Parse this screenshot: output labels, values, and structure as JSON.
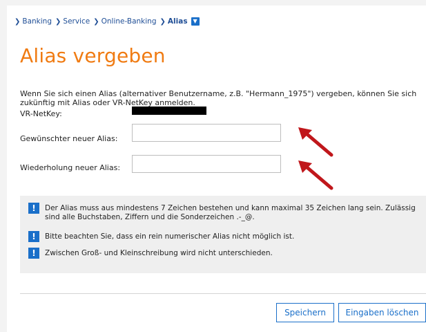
{
  "breadcrumb": {
    "items": [
      {
        "label": "Banking"
      },
      {
        "label": "Service"
      },
      {
        "label": "Online-Banking"
      },
      {
        "label": "Alias"
      }
    ],
    "toggle_icon": "chevron-down-icon"
  },
  "page": {
    "title": "Alias vergeben",
    "intro": "Wenn Sie sich einen Alias (alternativer Benutzername, z.B. \"Hermann_1975\") vergeben, können Sie sich zukünftig mit Alias oder VR-NetKey anmelden."
  },
  "netkey": {
    "label": "VR-NetKey:",
    "value_redacted": true
  },
  "form": {
    "new_alias_label": "Gewünschter neuer Alias:",
    "new_alias_value": "",
    "repeat_alias_label": "Wiederholung neuer Alias:",
    "repeat_alias_value": ""
  },
  "annotations": {
    "arrow_color": "#c0171b"
  },
  "info": {
    "icon": "exclamation-icon",
    "items": [
      {
        "text": "Der Alias muss aus mindestens 7 Zeichen bestehen und kann maximal 35 Zeichen lang sein. Zulässig sind alle Buchstaben, Ziffern und die Sonderzeichen .-_@."
      },
      {
        "text": "Bitte beachten Sie, dass ein rein numerischer Alias nicht möglich ist."
      },
      {
        "text": "Zwischen Groß- und Kleinschreibung wird nicht unterschieden."
      }
    ]
  },
  "actions": {
    "save_label": "Speichern",
    "clear_label": "Eingaben löschen"
  },
  "colors": {
    "accent": "#1a6fc9",
    "title": "#f07b12",
    "background": "#f3f3f3"
  }
}
